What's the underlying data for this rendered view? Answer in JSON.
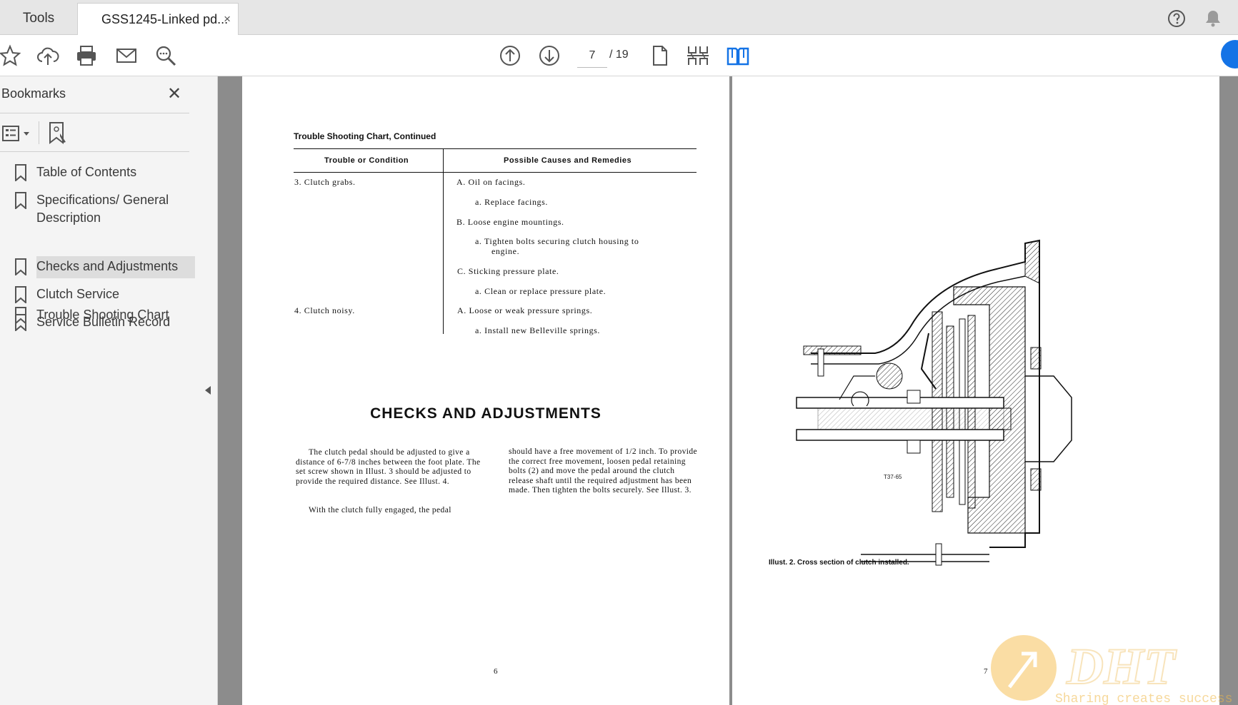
{
  "tabs": {
    "tools_label": "Tools",
    "document_label": "GSS1245-Linked pd...",
    "close_glyph": "×"
  },
  "toolbar": {
    "left_icons": [
      "star-icon",
      "cloud-upload-icon",
      "print-icon",
      "mail-icon",
      "zoom-search-icon"
    ],
    "current_page": "7",
    "total_pages": "/ 19",
    "view_icons": [
      "page-up-icon",
      "page-down-icon",
      "single-page-icon",
      "page-thumbnails-icon",
      "two-page-view-icon"
    ],
    "accent_color": "#1473e6"
  },
  "bookmarks": {
    "title": "Bookmarks",
    "close_glyph": "✕",
    "items": [
      {
        "label": "Table of Contents"
      },
      {
        "label": "Specifications/ General\nDescription"
      },
      {
        "label": "Trouble Shooting Chart"
      },
      {
        "label": "Checks and Adjustments",
        "selected": true
      },
      {
        "label": "Clutch Service"
      },
      {
        "label": "Service Bulletin Record"
      }
    ]
  },
  "left_page": {
    "chart_title": "Trouble Shooting Chart, Continued",
    "col1_header": "Trouble or Condition",
    "col2_header": "Possible Causes and Remedies",
    "trouble3": "3.  Clutch grabs.",
    "trouble4": "4.  Clutch noisy.",
    "remedies": [
      "A.  Oil on facings.",
      "a.  Replace facings.",
      "B.  Loose engine mountings.",
      "a.  Tighten bolts securing clutch housing to",
      "engine.",
      "C.  Sticking pressure plate.",
      "a.  Clean or replace pressure plate.",
      "A.  Loose or weak pressure springs.",
      "a.  Install new Belleville springs."
    ],
    "heading": "CHECKS AND ADJUSTMENTS",
    "para_left_1": "The clutch pedal should be adjusted to give a distance of 6-7/8 inches between the foot plate.  The set screw shown in Illust. 3 should be adjusted to provide the required distance.  See Illust. 4.",
    "para_left_2": "With the clutch fully engaged, the pedal",
    "para_right": "should have a free movement of 1/2 inch. To provide the correct free movement, loosen pedal retaining bolts (2) and move the pedal around the clutch release shaft until the required adjustment has been made.  Then tighten the bolts securely. See Illust. 3.",
    "page_number": "6"
  },
  "right_page": {
    "figure_code": "T37-65",
    "caption": "Illust. 2.  Cross section of clutch installed.",
    "page_number": "7"
  },
  "watermark": {
    "brand": "DHT",
    "slogan": "Sharing creates success"
  }
}
